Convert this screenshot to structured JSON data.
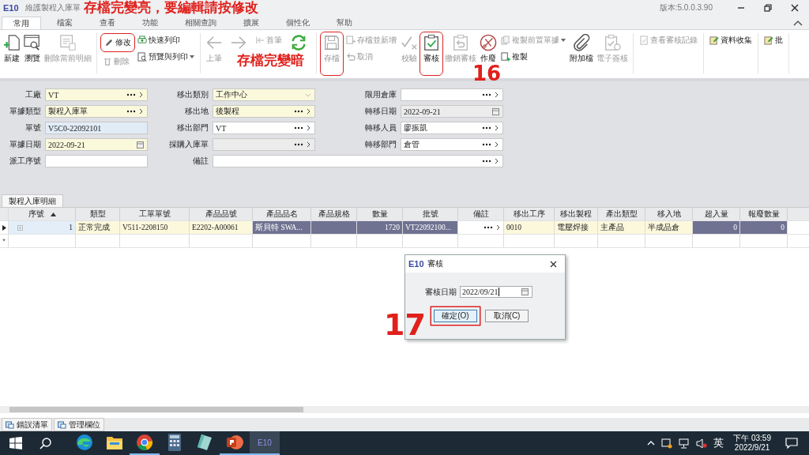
{
  "window": {
    "logo": "E10",
    "title": "維護製程入庫單",
    "version": "版本:5.0.0.3.90"
  },
  "tabs": [
    {
      "label": "常用",
      "selected": true
    },
    {
      "label": "檔案",
      "selected": false
    },
    {
      "label": "查看",
      "selected": false
    },
    {
      "label": "功能",
      "selected": false
    },
    {
      "label": "相關查詢",
      "selected": false
    },
    {
      "label": "擴展",
      "selected": false
    },
    {
      "label": "個性化",
      "selected": false
    },
    {
      "label": "幫助",
      "selected": false
    }
  ],
  "ribbon": [
    {
      "columns": [
        {
          "kind": "large",
          "label": "新建",
          "disabled": false,
          "highlighted": false
        },
        {
          "kind": "large",
          "label": "瀏覽",
          "disabled": false,
          "highlighted": false
        },
        {
          "kind": "large",
          "label": "刪除當前明細",
          "disabled": true,
          "highlighted": false
        }
      ]
    },
    {
      "columns": [
        {
          "kind": "stack",
          "items": [
            {
              "label": "修改",
              "disabled": false,
              "highlighted": true,
              "dropdown": false
            },
            {
              "label": "刪除",
              "disabled": true,
              "highlighted": false,
              "dropdown": false
            }
          ]
        },
        {
          "kind": "stack",
          "items": [
            {
              "label": "快速列印",
              "disabled": false,
              "highlighted": false,
              "dropdown": false
            },
            {
              "label": "預覽與列印",
              "disabled": false,
              "highlighted": false,
              "dropdown": true
            }
          ]
        }
      ]
    },
    {
      "columns": [
        {
          "kind": "large",
          "label": "上筆",
          "disabled": true,
          "highlighted": false
        },
        {
          "kind": "large",
          "disabled": true,
          "highlighted": false
        },
        {
          "kind": "stack",
          "items": [
            {
              "label": "首筆",
              "disabled": true,
              "highlighted": false,
              "dropdown": false
            }
          ]
        },
        {
          "kind": "large",
          "disabled": false,
          "highlighted": false
        }
      ]
    },
    {
      "columns": [
        {
          "kind": "large",
          "label": "存檔",
          "disabled": true,
          "highlighted": true
        },
        {
          "kind": "stack",
          "items": [
            {
              "label": "存檔並新增",
              "disabled": true,
              "highlighted": false,
              "dropdown": false
            },
            {
              "label": "取消",
              "disabled": true,
              "highlighted": false,
              "dropdown": false
            }
          ]
        },
        {
          "kind": "large",
          "label": "校驗",
          "disabled": true,
          "highlighted": false
        },
        {
          "kind": "large",
          "label": "審核",
          "disabled": false,
          "highlighted": true
        },
        {
          "kind": "large",
          "label": "撤銷審核",
          "disabled": true,
          "highlighted": false
        },
        {
          "kind": "large",
          "label": "作廢",
          "disabled": false,
          "highlighted": false
        },
        {
          "kind": "stack",
          "items": [
            {
              "label": "複製前置單據",
              "disabled": true,
              "highlighted": false,
              "dropdown": true
            },
            {
              "label": "複製",
              "disabled": false,
              "highlighted": false,
              "dropdown": false
            }
          ]
        },
        {
          "kind": "large",
          "label": "附加檔",
          "disabled": false,
          "highlighted": false
        },
        {
          "kind": "large",
          "label": "電子簽核",
          "disabled": true,
          "highlighted": false
        }
      ]
    },
    {
      "columns": [
        {
          "kind": "stack",
          "items": [
            {
              "label": "查看審核記錄",
              "disabled": true,
              "highlighted": false,
              "dropdown": false
            }
          ]
        }
      ]
    },
    {
      "columns": [
        {
          "kind": "stack",
          "items": [
            {
              "label": "資料收集",
              "disabled": false,
              "highlighted": false,
              "dropdown": false
            }
          ]
        }
      ]
    },
    {
      "columns": [
        {
          "kind": "stack",
          "items": [
            {
              "label": "批",
              "disabled": false,
              "highlighted": false,
              "dropdown": false
            }
          ]
        }
      ]
    }
  ],
  "form": [
    [
      {
        "label": "工廠",
        "value": "VT",
        "kind": "lookup",
        "required": true,
        "readonly": false,
        "focused": false
      },
      {
        "label": "移出類別",
        "value": "工作中心",
        "kind": "select",
        "required": true,
        "readonly": false,
        "focused": false
      },
      {
        "label": "限用倉庫",
        "kind": "lookup",
        "required": false,
        "readonly": false,
        "focused": false
      }
    ],
    [
      {
        "label": "單據類型",
        "value": "製程入庫單",
        "kind": "lookup",
        "required": true,
        "readonly": false,
        "focused": false
      },
      {
        "label": "移出地",
        "value": "後製程",
        "kind": "lookup",
        "required": true,
        "readonly": false,
        "focused": false
      },
      {
        "label": "轉移日期",
        "value": "2022-09-21",
        "kind": "date",
        "required": false,
        "readonly": true,
        "focused": false
      }
    ],
    [
      {
        "label": "單號",
        "value": "V5C0-22092101",
        "kind": "text",
        "required": false,
        "readonly": false,
        "focused": true
      },
      {
        "label": "移出部門",
        "value": "VT",
        "kind": "lookup",
        "required": false,
        "readonly": false,
        "focused": false
      },
      {
        "label": "轉移人員",
        "value": "廖振凱",
        "kind": "lookup",
        "required": false,
        "readonly": false,
        "focused": false
      }
    ],
    [
      {
        "label": "單據日期",
        "value": "2022-09-21",
        "kind": "date",
        "required": true,
        "readonly": false,
        "focused": false
      },
      {
        "label": "採購入庫單",
        "kind": "lookup",
        "required": false,
        "readonly": true,
        "focused": false
      },
      {
        "label": "轉移部門",
        "value": "倉管",
        "kind": "lookup",
        "required": false,
        "readonly": false,
        "focused": false
      }
    ],
    [
      {
        "label": "派工序號",
        "kind": "text",
        "required": false,
        "readonly": false,
        "focused": false
      },
      {
        "label": "備註",
        "kind": "lookup",
        "required": false,
        "readonly": false,
        "focused": false
      }
    ]
  ],
  "detail_tab": "製程入庫明細",
  "table": {
    "columns": [
      {
        "label": "序號",
        "sorted": true
      },
      {
        "label": "類型",
        "sorted": false
      },
      {
        "label": "工單單號",
        "sorted": false
      },
      {
        "label": "產品品號",
        "sorted": false
      },
      {
        "label": "產品品名",
        "sorted": false
      },
      {
        "label": "產品規格",
        "sorted": false
      },
      {
        "label": "數量",
        "sorted": false
      },
      {
        "label": "批號",
        "sorted": false
      },
      {
        "label": "備註",
        "sorted": false
      },
      {
        "label": "移出工序",
        "sorted": false
      },
      {
        "label": "移出製程",
        "sorted": false
      },
      {
        "label": "產出類型",
        "sorted": false
      },
      {
        "label": "移入地",
        "sorted": false
      },
      {
        "label": "超入量",
        "sorted": false
      },
      {
        "label": "報廢數量",
        "sorted": false
      }
    ],
    "rows": [
      {
        "selected": true,
        "cells": [
          {
            "text": "1",
            "kind": "index",
            "required": false,
            "readonly": false,
            "focused": true
          },
          {
            "text": "正常完成",
            "kind": "text",
            "required": true,
            "readonly": false,
            "focused": false
          },
          {
            "text": "V511-2208150",
            "kind": "text",
            "required": true,
            "readonly": false,
            "focused": false
          },
          {
            "text": "E2202-A00061",
            "kind": "text",
            "required": true,
            "readonly": false,
            "focused": false
          },
          {
            "text": "斯貝特 SWA...",
            "kind": "text",
            "required": false,
            "readonly": true,
            "focused": false
          },
          {
            "kind": "text",
            "required": false,
            "readonly": true,
            "focused": false
          },
          {
            "text": "1720",
            "kind": "number",
            "required": false,
            "readonly": true,
            "focused": false
          },
          {
            "text": "VT22092100...",
            "kind": "text",
            "required": false,
            "readonly": true,
            "focused": false
          },
          {
            "kind": "lookup",
            "required": false,
            "readonly": false,
            "focused": false
          },
          {
            "text": "0010",
            "kind": "text",
            "required": true,
            "readonly": false,
            "focused": false
          },
          {
            "text": "電壓焊接",
            "kind": "text",
            "required": true,
            "readonly": false,
            "focused": false
          },
          {
            "text": "主產品",
            "kind": "text",
            "required": true,
            "readonly": false,
            "focused": false
          },
          {
            "text": "半成品倉",
            "kind": "text",
            "required": true,
            "readonly": false,
            "focused": false
          },
          {
            "text": "0",
            "kind": "number",
            "required": false,
            "readonly": true,
            "focused": false
          },
          {
            "text": "0",
            "kind": "number",
            "required": false,
            "readonly": true,
            "focused": false
          }
        ]
      }
    ],
    "new_row_marker": "*"
  },
  "bottom_tabs": [
    {
      "label": "錯誤清單"
    },
    {
      "label": "管理欄位"
    }
  ],
  "dialog": {
    "logo": "E10",
    "title": "審核",
    "field_label": "審核日期",
    "field_value": "2022/09/21",
    "buttons": [
      {
        "label": "確定(O)",
        "highlighted": true
      },
      {
        "label": "取消(C)",
        "highlighted": false
      }
    ]
  },
  "annotations": [
    {
      "text": "存檔完變亮，要編輯請按修改"
    },
    {
      "text": "存檔完變暗"
    },
    {
      "text": "16"
    },
    {
      "text": "17"
    }
  ],
  "taskbar": {
    "apps": [
      {
        "kind": "edge",
        "running": false,
        "selected": false
      },
      {
        "kind": "folder",
        "running": false,
        "selected": false
      },
      {
        "kind": "chrome",
        "running": true,
        "selected": false
      },
      {
        "kind": "calculator",
        "running": false,
        "selected": false
      },
      {
        "kind": "notes",
        "running": false,
        "selected": false
      },
      {
        "kind": "powerpoint",
        "running": true,
        "selected": false
      },
      {
        "kind": "erp",
        "label": "E10",
        "running": true,
        "selected": true
      }
    ],
    "ime": "英",
    "time": "下午 03:59",
    "date": "2022/9/21"
  }
}
